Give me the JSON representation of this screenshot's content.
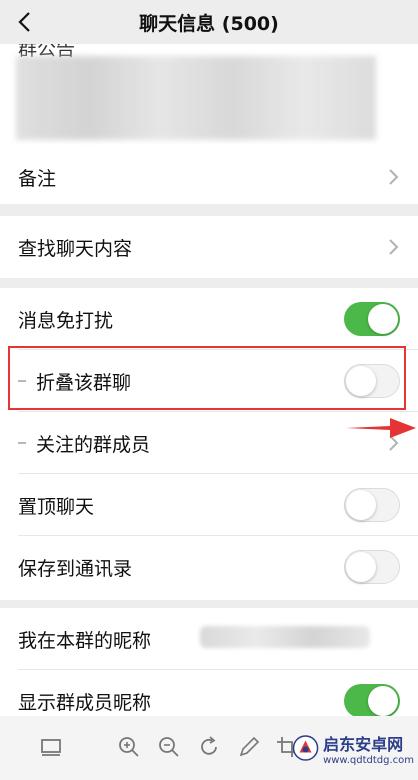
{
  "header": {
    "title": "聊天信息 (500)"
  },
  "announcement": {
    "label": "群公告"
  },
  "rows": {
    "remark": "备注",
    "search_history": "查找聊天内容",
    "mute": "消息免打扰",
    "fold": "折叠该群聊",
    "followed": "关注的群成员",
    "pin": "置顶聊天",
    "save_contacts": "保存到通讯录",
    "my_nickname": "我在本群的昵称",
    "show_nicknames": "显示群成员昵称"
  },
  "toggles": {
    "mute": true,
    "fold": false,
    "pin": false,
    "save_contacts": false,
    "show_nicknames": true
  },
  "watermark": {
    "name": "启东安卓网",
    "url": "www.qdtdtdg.com"
  },
  "colors": {
    "toggle_on": "#4cb849",
    "highlight": "#e53434",
    "arrow": "#e53434"
  }
}
